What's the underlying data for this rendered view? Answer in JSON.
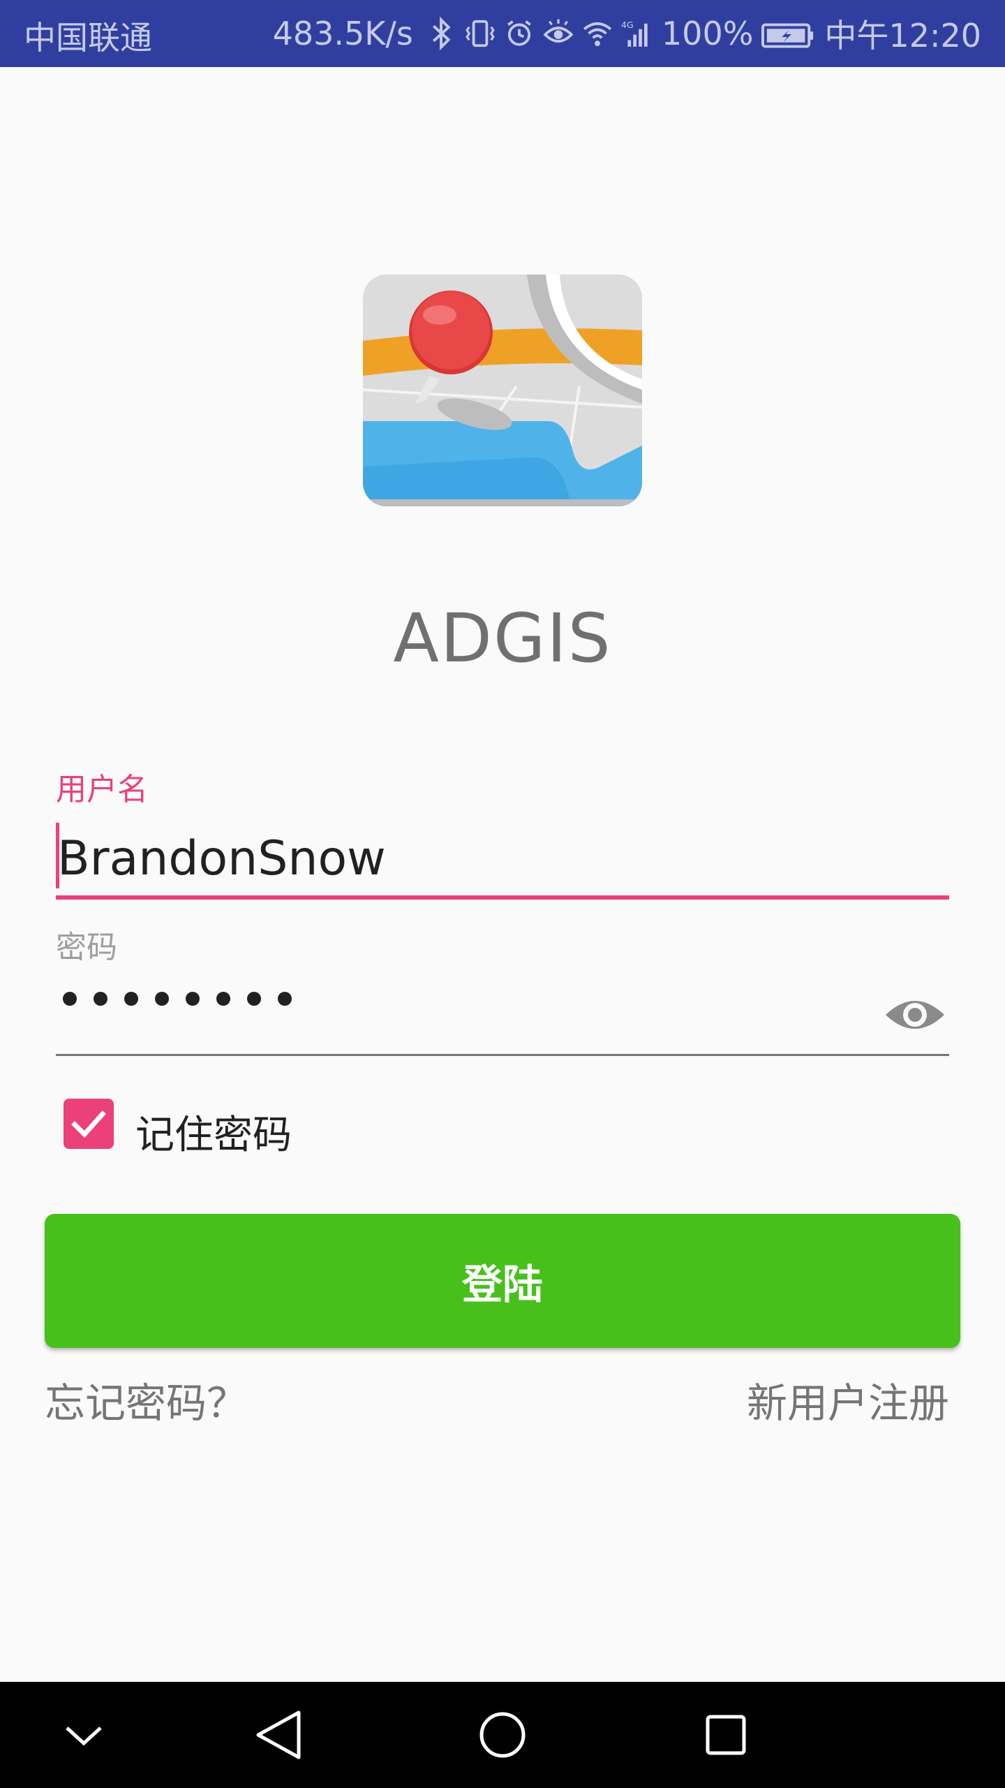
{
  "status_bar": {
    "carrier": "中国联通",
    "speed": "483.5K/s",
    "battery": "100%",
    "time": "中午12:20",
    "icons": [
      "bluetooth-icon",
      "vibrate-icon",
      "alarm-icon",
      "eye-comfort-icon",
      "wifi-icon",
      "signal-4g-icon",
      "battery-charging-icon"
    ]
  },
  "app": {
    "title": "ADGIS",
    "logo": "map-pin-icon"
  },
  "form": {
    "username_label": "用户名",
    "username_value": "BrandonSnow",
    "password_label": "密码",
    "password_value": "••••••••",
    "remember_label": "记住密码",
    "remember_checked": true,
    "login_label": "登陆",
    "forgot_label": "忘记密码？",
    "register_label": "新用户注册"
  },
  "colors": {
    "accent": "#ec407a",
    "primary_dark": "#303f9f",
    "login_button": "#47c01c"
  },
  "nav_bar": {
    "icons": [
      "collapse-icon",
      "back-icon",
      "home-icon",
      "recents-icon"
    ]
  }
}
